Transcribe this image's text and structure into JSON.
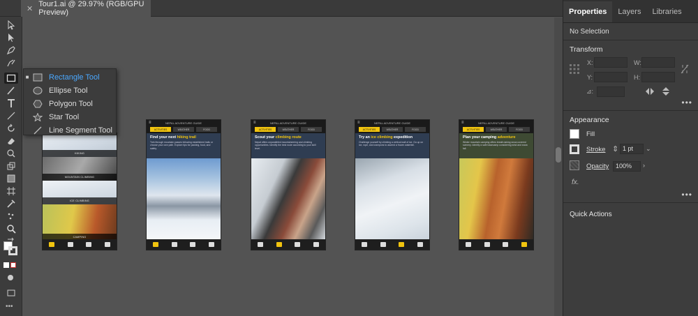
{
  "document_tab": {
    "title": "Tour1.ai @ 29.97% (RGB/GPU Preview)",
    "close_glyph": "✕"
  },
  "shape_flyout": {
    "items": [
      {
        "label": "Rectangle Tool",
        "icon": "rectangle-icon",
        "selected": true
      },
      {
        "label": "Ellipse Tool",
        "icon": "ellipse-icon",
        "selected": false
      },
      {
        "label": "Polygon Tool",
        "icon": "polygon-icon",
        "selected": false
      },
      {
        "label": "Star Tool",
        "icon": "star-icon",
        "selected": false
      },
      {
        "label": "Line Segment Tool",
        "icon": "line-segment-icon",
        "selected": false
      }
    ]
  },
  "artboards": {
    "brand": "NEPAL ADVENTURE GUIDE",
    "tabs": [
      "ACTIVITIES",
      "WEATHER",
      "FOOD"
    ],
    "list_captions": [
      "HIKING",
      "MOUNTAIN CLIMBING",
      "ICE CLIMBING",
      "CAMPING"
    ],
    "screens": [
      {
        "title_plain": "Find your next ",
        "title_accent": "hiking trail",
        "title_tail": "",
        "body": "Trek through mountain passes following established trails or choose your own path. Explore tips for packing, food, and safety."
      },
      {
        "title_plain": "Scout your ",
        "title_accent": "climbing route",
        "title_tail": "",
        "body": "Nepal offers unparalleled mountaineering and climbing opportunities. Identify the best route according to your skill level."
      },
      {
        "title_plain": "Try an ",
        "title_accent": "ice climbing",
        "title_tail": " expedition",
        "body": "Challenge yourself by climbing a vertical wall of ice. Go up on ice, rope, and crampons to ascend a frozen waterfall."
      },
      {
        "title_plain": "Plan your camping ",
        "title_accent": "adventure",
        "title_tail": "",
        "body": "Winter mountain camping offers breath-taking snow-covered scenery. Identify a safe basecamp considering wind and snow fall."
      }
    ]
  },
  "properties_panel": {
    "tabs": [
      "Properties",
      "Layers",
      "Libraries"
    ],
    "selection": "No Selection",
    "transform": {
      "title": "Transform",
      "x_label": "X:",
      "y_label": "Y:",
      "w_label": "W:",
      "h_label": "H:",
      "angle_glyph": "⊿:"
    },
    "appearance": {
      "title": "Appearance",
      "fill_label": "Fill",
      "stroke_label": "Stroke",
      "stroke_value": "1 pt",
      "opacity_label": "Opacity",
      "opacity_value": "100%",
      "fx_label": "fx."
    },
    "quick_actions": "Quick Actions",
    "more_glyph": "•••"
  },
  "colors": {
    "accent": "#f1c40f",
    "selection_blue": "#4aa8ff",
    "panel_bg": "#3d3d3d",
    "canvas_bg": "#535353"
  }
}
